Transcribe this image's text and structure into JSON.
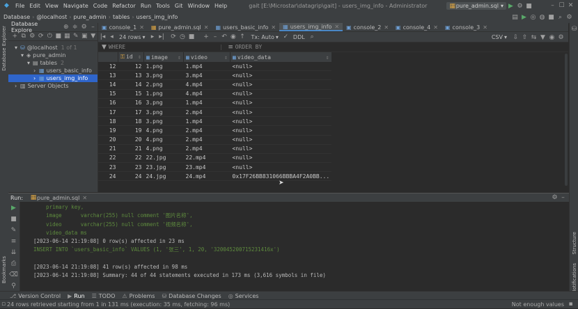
{
  "titlebar": {
    "menu": [
      "File",
      "Edit",
      "View",
      "Navigate",
      "Code",
      "Refactor",
      "Run",
      "Tools",
      "Git",
      "Window",
      "Help"
    ],
    "title": "gait [E:\\Microstar\\datagrip\\gait] - users_img_info - Administrator",
    "run_config": "pure_admin.sql"
  },
  "navbar": {
    "crumbs": [
      "Database",
      "@localhost",
      "pure_admin",
      "tables",
      "users_img_info"
    ]
  },
  "leftstripe": {
    "label1": "Database Explorer",
    "label2": "Bookmarks"
  },
  "rightstripe": {
    "label1": "Structure",
    "label2": "Notifications"
  },
  "db_explorer": {
    "title": "Database Explore",
    "tree": [
      {
        "label": "@localhost",
        "badge": "1 of 1",
        "depth": 1
      },
      {
        "label": "pure_admin",
        "depth": 2
      },
      {
        "label": "tables",
        "badge": "2",
        "depth": 3
      },
      {
        "label": "users_basic_info",
        "depth": 4
      },
      {
        "label": "users_img_info",
        "depth": 4
      },
      {
        "label": "Server Objects",
        "depth": 1
      }
    ]
  },
  "tabs": [
    "console_1",
    "pure_admin.sql",
    "users_basic_info",
    "users_img_info",
    "console_2",
    "console_4",
    "console_3"
  ],
  "grid_toolbar": {
    "rows": "24 rows",
    "tx": "Tx: Auto",
    "ddl": "DDL",
    "export": "CSV"
  },
  "filter": {
    "where": "WHERE",
    "order": "ORDER BY"
  },
  "columns": [
    "id",
    "image",
    "video",
    "video_data"
  ],
  "rows": [
    {
      "n": "12",
      "id": "12",
      "image": "1.png",
      "video": "1.mp4",
      "data": "<null>"
    },
    {
      "n": "13",
      "id": "13",
      "image": "3.png",
      "video": "3.mp4",
      "data": "<null>"
    },
    {
      "n": "14",
      "id": "14",
      "image": "2.png",
      "video": "4.mp4",
      "data": "<null>"
    },
    {
      "n": "15",
      "id": "15",
      "image": "1.png",
      "video": "4.mp4",
      "data": "<null>"
    },
    {
      "n": "16",
      "id": "16",
      "image": "3.png",
      "video": "1.mp4",
      "data": "<null>"
    },
    {
      "n": "17",
      "id": "17",
      "image": "3.png",
      "video": "2.mp4",
      "data": "<null>"
    },
    {
      "n": "18",
      "id": "18",
      "image": "3.png",
      "video": "1.mp4",
      "data": "<null>"
    },
    {
      "n": "19",
      "id": "19",
      "image": "4.png",
      "video": "2.mp4",
      "data": "<null>"
    },
    {
      "n": "20",
      "id": "20",
      "image": "4.png",
      "video": "2.mp4",
      "data": "<null>"
    },
    {
      "n": "21",
      "id": "21",
      "image": "4.png",
      "video": "2.mp4",
      "data": "<null>"
    },
    {
      "n": "22",
      "id": "22",
      "image": "22.jpg",
      "video": "22.mp4",
      "data": "<null>"
    },
    {
      "n": "23",
      "id": "23",
      "image": "23.jpg",
      "video": "23.mp4",
      "data": "<null>"
    },
    {
      "n": "24",
      "id": "24",
      "image": "24.jpg",
      "video": "24.mp4",
      "data": "0x17F26BB831066BBBA4F2A0BB..."
    }
  ],
  "run": {
    "label": "Run:",
    "tab": "pure_admin.sql",
    "log": [
      {
        "text": "    primary key,",
        "c": "g1"
      },
      {
        "text": "    image      varchar(255) null comment '图片名称',",
        "c": "g1"
      },
      {
        "text": "    video      varchar(255) null comment '视频名称',",
        "c": "g1"
      },
      {
        "text": "    video_data ms",
        "c": "g1"
      },
      {
        "text": "[2023-06-14 21:19:08] 0 row(s) affected in 23 ms",
        "c": "w1"
      },
      {
        "text": "INSERT INTO `users_basic_info` VALUES (1, '张三', 1, 20, '320045200715231416x')",
        "c": "g1"
      },
      {
        "text": "",
        "c": "w1"
      },
      {
        "text": "[2023-06-14 21:19:08] 41 row(s) affected in 98 ms",
        "c": "w1"
      },
      {
        "text": "[2023-06-14 21:19:08] Summary: 44 of 44 statements executed in 173 ms (3,616 symbols in file)",
        "c": "w1"
      }
    ]
  },
  "bottom_tabs": [
    "Version Control",
    "Run",
    "TODO",
    "Problems",
    "Database Changes",
    "Services"
  ],
  "status": {
    "left": "24 rows retrieved starting from 1 in 131 ms (execution: 35 ms, fetching: 96 ms)",
    "right": "Not enough values"
  }
}
